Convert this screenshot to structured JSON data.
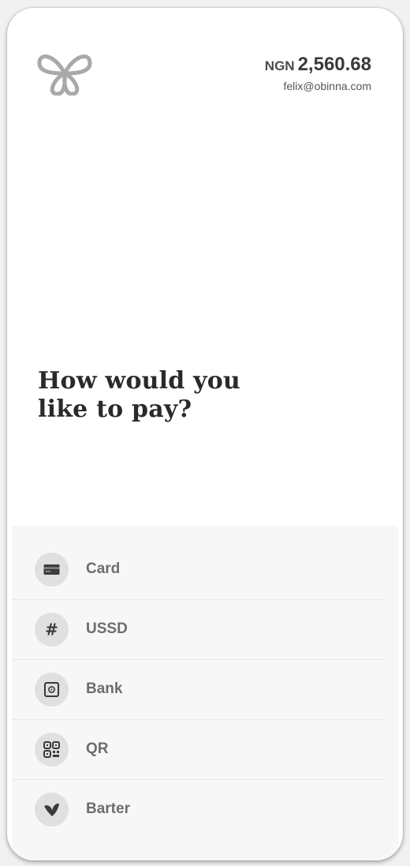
{
  "header": {
    "currency": "NGN",
    "amount": "2,560.68",
    "email": "felix@obinna.com",
    "logo_icon": "butterfly-logo-icon"
  },
  "title": {
    "line1": "How would you",
    "line2": "like to pay?"
  },
  "payment_methods": [
    {
      "label": "Card",
      "icon": "credit-card-icon"
    },
    {
      "label": "USSD",
      "icon": "hash-icon"
    },
    {
      "label": "Bank",
      "icon": "bank-vault-icon"
    },
    {
      "label": "QR",
      "icon": "qr-code-icon"
    },
    {
      "label": "Barter",
      "icon": "barter-icon"
    }
  ],
  "colors": {
    "background": "#f1f1f1",
    "card": "#ffffff",
    "methods_panel": "#f7f7f7",
    "icon_circle": "#e0e0e0",
    "title_text": "#2a2a2a",
    "method_text": "#6d6d6d"
  }
}
